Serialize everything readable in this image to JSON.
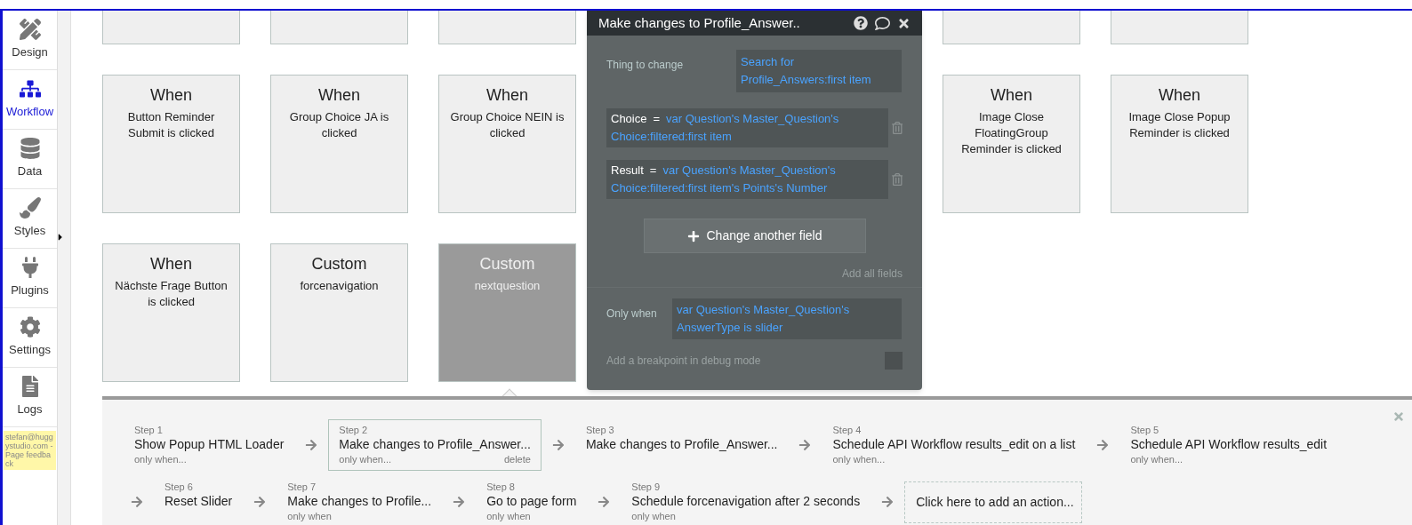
{
  "sidebar": {
    "items": [
      {
        "label": "Design",
        "selected": false
      },
      {
        "label": "Workflow",
        "selected": true
      },
      {
        "label": "Data",
        "selected": false
      },
      {
        "label": "Styles",
        "selected": false
      },
      {
        "label": "Plugins",
        "selected": false
      },
      {
        "label": "Settings",
        "selected": false
      },
      {
        "label": "Logs",
        "selected": false
      }
    ],
    "feedback_note": "stefan@huggystudio.com - Page feedback"
  },
  "canvas": {
    "rows": [
      [
        {
          "kind": "clipped",
          "selected": false
        },
        {
          "kind": "clipped",
          "selected": false
        },
        {
          "kind": "clipped",
          "selected": false
        },
        {
          "kind": "clipped",
          "selected": false
        },
        {
          "kind": "clipped",
          "selected": false
        }
      ],
      [
        {
          "kind": "event",
          "title": "When",
          "text": "Button Reminder Submit is clicked",
          "selected": false
        },
        {
          "kind": "event",
          "title": "When",
          "text": "Group Choice JA is clicked",
          "selected": false
        },
        {
          "kind": "event",
          "title": "When",
          "text": "Group Choice NEIN is clicked",
          "selected": false
        },
        {
          "kind": "event",
          "title": "When",
          "text": "Image Close FloatingGroup Reminder is clicked",
          "selected": false
        },
        {
          "kind": "event",
          "title": "When",
          "text": "Image Close Popup Reminder is clicked",
          "selected": false
        }
      ],
      [
        {
          "kind": "event",
          "title": "When",
          "text": "Nächste Frage Button is clicked",
          "selected": false
        },
        {
          "kind": "event",
          "title": "Custom",
          "text": "forcenavigation",
          "selected": false
        },
        {
          "kind": "event",
          "title": "Custom",
          "text": "nextquestion",
          "selected": true
        }
      ]
    ]
  },
  "popup": {
    "title": "Make changes to Profile_Answer..",
    "thing_label": "Thing to change",
    "thing_value": "Search for Profile_Answers:first item",
    "fields": [
      {
        "name": "Choice",
        "operator": "=",
        "value": "var Question's Master_Question's Choice:filtered:first item"
      },
      {
        "name": "Result",
        "operator": "=",
        "value": "var Question's Master_Question's Choice:filtered:first item's Points's Number"
      }
    ],
    "add_button": "Change another field",
    "add_all": "Add all fields",
    "only_when_label": "Only when",
    "only_when_value": "var Question's Master_Question's AnswerType is slider",
    "breakpoint_label": "Add a breakpoint in debug mode",
    "breakpoint_checked": false
  },
  "steps": {
    "items": [
      {
        "label": "Step 1",
        "action": "Show Popup HTML Loader",
        "condition": "only when...",
        "selected": false
      },
      {
        "label": "Step 2",
        "action": "Make changes to Profile_Answer...",
        "condition": "only when...",
        "delete": "delete",
        "selected": true
      },
      {
        "label": "Step 3",
        "action": "Make changes to Profile_Answer...",
        "selected": false
      },
      {
        "label": "Step 4",
        "action": "Schedule API Workflow results_edit on a list",
        "condition": "only when...",
        "selected": false
      },
      {
        "label": "Step 5",
        "action": "Schedule API Workflow results_edit",
        "condition": "only when...",
        "selected": false
      },
      {
        "label": "Step 6",
        "action": "Reset Slider",
        "selected": false
      },
      {
        "label": "Step 7",
        "action": "Make changes to Profile...",
        "condition": "only when",
        "selected": false
      },
      {
        "label": "Step 8",
        "action": "Go to page form",
        "condition": "only when",
        "selected": false
      },
      {
        "label": "Step 9",
        "action": "Schedule forcenavigation after 2 seconds",
        "condition": "only when",
        "selected": false
      }
    ],
    "add_action": "Click here to add an action..."
  }
}
